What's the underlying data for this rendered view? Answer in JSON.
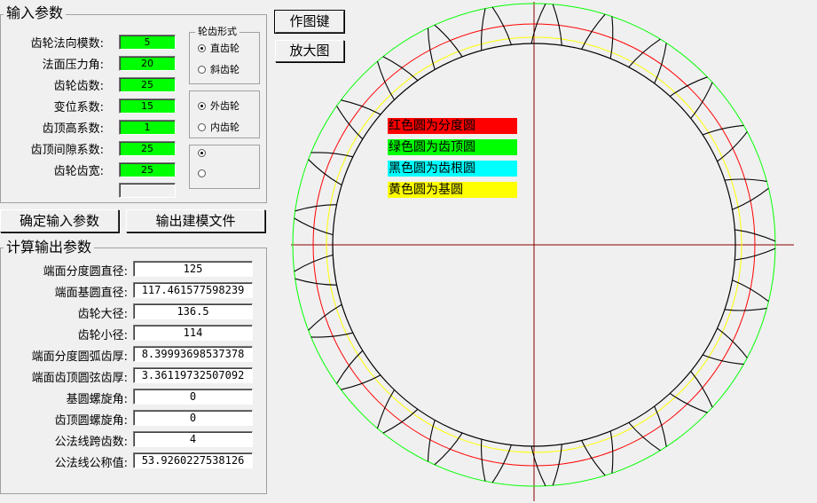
{
  "input_group": {
    "title": "输入参数",
    "fields": [
      {
        "label": "齿轮法向模数:",
        "value": "5"
      },
      {
        "label": "法面压力角:",
        "value": "20"
      },
      {
        "label": "齿轮齿数:",
        "value": "25"
      },
      {
        "label": "变位系数:",
        "value": "15"
      },
      {
        "label": "齿顶高系数:",
        "value": "1"
      },
      {
        "label": "齿顶间隙系数:",
        "value": "25"
      },
      {
        "label": "齿轮齿宽:",
        "value": "25"
      }
    ],
    "extra_field_value": ""
  },
  "gear_form": {
    "title": "轮齿形式",
    "options": [
      "直齿轮",
      "斜齿轮"
    ],
    "selected": "直齿轮"
  },
  "gear_type": {
    "options": [
      "外齿轮",
      "内齿轮"
    ],
    "selected": "外齿轮"
  },
  "buttons": {
    "draw": "作图键",
    "zoom": "放大图",
    "confirm": "确定输入参数",
    "export": "输出建模文件"
  },
  "output_group": {
    "title": "计算输出参数",
    "rows": [
      {
        "label": "端面分度圆直径:",
        "value": "125"
      },
      {
        "label": "端面基圆直径:",
        "value": "117.461577598239"
      },
      {
        "label": "齿轮大径:",
        "value": "136.5"
      },
      {
        "label": "齿轮小径:",
        "value": "114"
      },
      {
        "label": "端面分度圆弧齿厚:",
        "value": "8.39993698537378"
      },
      {
        "label": "端面齿顶圆弦齿厚:",
        "value": "3.36119732507092"
      },
      {
        "label": "基圆螺旋角:",
        "value": "0"
      },
      {
        "label": "齿顶圆螺旋角:",
        "value": "0"
      },
      {
        "label": "公法线跨齿数:",
        "value": "4"
      },
      {
        "label": "公法线公称值:",
        "value": "53.9260227538126"
      }
    ]
  },
  "legend": [
    {
      "text": "红色圆为分度圆",
      "bg": "#ff0000"
    },
    {
      "text": "绿色圆为齿顶圆",
      "bg": "#00ff00"
    },
    {
      "text": "黑色圆为齿根圆",
      "bg": "#00ffff"
    },
    {
      "text": "黄色圆为基圆",
      "bg": "#ffff00"
    }
  ],
  "drawing": {
    "teeth": 25,
    "colors": {
      "pitch": "#ff0000",
      "tip": "#00ff00",
      "root": "#000000",
      "base": "#ffff00",
      "axis": "#8b0000",
      "profile": "#000000"
    }
  }
}
